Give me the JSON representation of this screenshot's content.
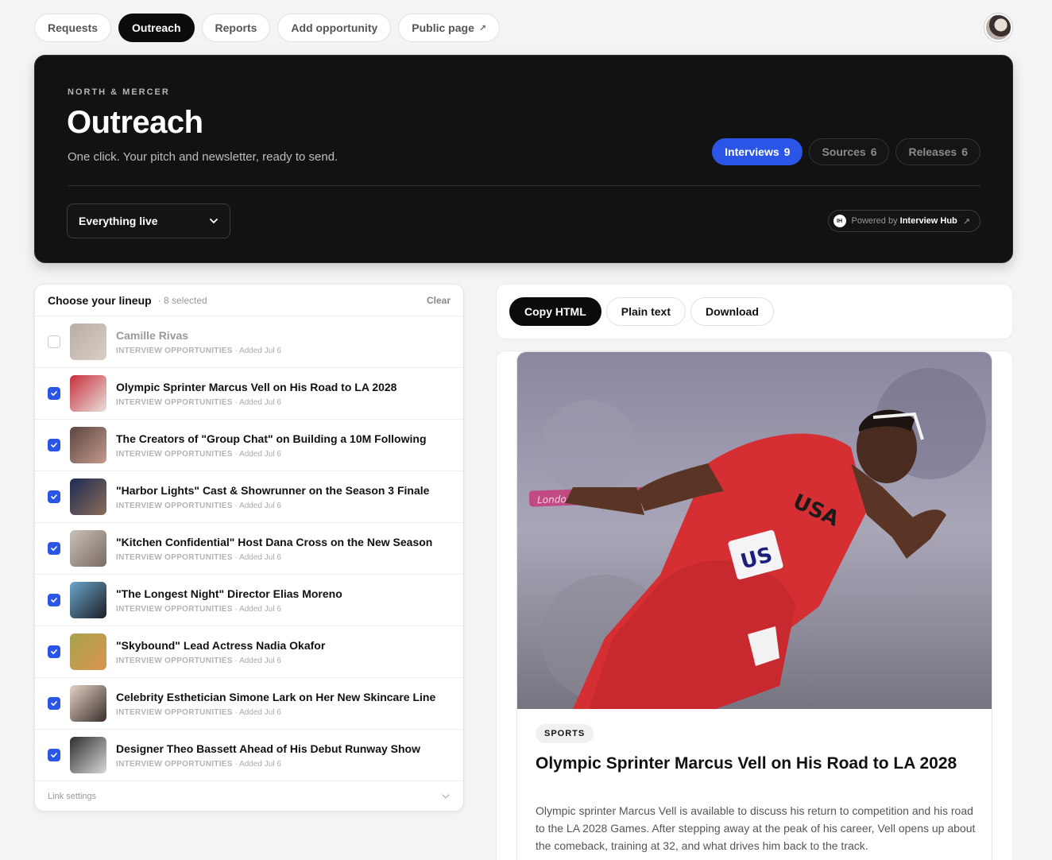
{
  "nav": {
    "tabs": [
      {
        "label": "Requests",
        "active": false
      },
      {
        "label": "Outreach",
        "active": true
      },
      {
        "label": "Reports",
        "active": false
      },
      {
        "label": "Add opportunity",
        "active": false
      },
      {
        "label": "Public page",
        "active": false,
        "external": true
      }
    ],
    "external_icon": "↗"
  },
  "hero": {
    "eyebrow": "NORTH & MERCER",
    "title": "Outreach",
    "subtitle": "One click. Your pitch and newsletter, ready to send.",
    "pills": [
      {
        "label": "Interviews",
        "count": "9",
        "active": true
      },
      {
        "label": "Sources",
        "count": "6",
        "active": false
      },
      {
        "label": "Releases",
        "count": "6",
        "active": false
      }
    ],
    "filter_value": "Everything live",
    "powered_prefix": "Powered by",
    "powered_brand": "Interview Hub",
    "powered_logo": "IH"
  },
  "lineup": {
    "title": "Choose your lineup",
    "selected": "· 8 selected",
    "clear": "Clear",
    "category": "INTERVIEW OPPORTUNITIES",
    "added": "· Added Jul 6",
    "items": [
      {
        "title": "Camille Rivas",
        "checked": false
      },
      {
        "title": "Olympic Sprinter Marcus Vell on His Road to LA 2028",
        "checked": true
      },
      {
        "title": "The Creators of \"Group Chat\" on Building a 10M Following",
        "checked": true
      },
      {
        "title": "\"Harbor Lights\" Cast & Showrunner on the Season 3 Finale",
        "checked": true
      },
      {
        "title": "\"Kitchen Confidential\" Host Dana Cross on the New Season",
        "checked": true
      },
      {
        "title": "\"The Longest Night\" Director Elias Moreno",
        "checked": true
      },
      {
        "title": "\"Skybound\" Lead Actress Nadia Okafor",
        "checked": true
      },
      {
        "title": "Celebrity Esthetician Simone Lark on Her New Skincare Line",
        "checked": true
      },
      {
        "title": "Designer Theo Bassett Ahead of His Debut Runway Show",
        "checked": true
      }
    ],
    "link_settings": "Link settings"
  },
  "actions": {
    "copy_html": "Copy HTML",
    "plain_text": "Plain text",
    "download": "Download"
  },
  "preview": {
    "tag": "SPORTS",
    "title": "Olympic Sprinter Marcus Vell on His Road to LA 2028",
    "body": "Olympic sprinter Marcus Vell is available to discuss his return to competition and his road to the LA 2028 Games. After stepping away at the peak of his career, Vell opens up about the comeback, training at 32, and what drives him back to the track.",
    "image_text": {
      "baton": "London 2012",
      "jersey": "USA",
      "bib": "US"
    }
  },
  "colors": {
    "accent": "#2b55e6",
    "dark": "#121212",
    "background": "#f4f4f4"
  },
  "icons": [
    "chevron-down-icon",
    "external-link-icon",
    "check-icon",
    "interview-hub-logo"
  ]
}
